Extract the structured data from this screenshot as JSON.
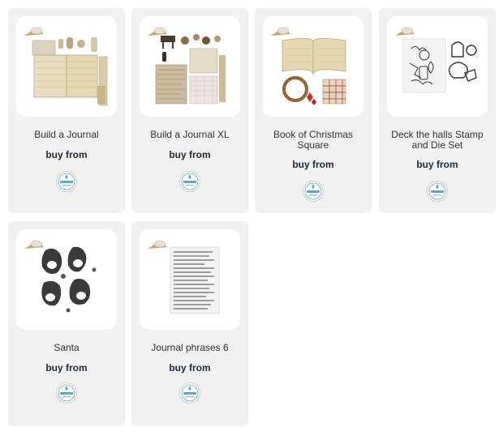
{
  "products": [
    {
      "title": "Build a Journal",
      "buy_label": "buy from",
      "retailer_logo": "elizabeth-craft-designs-logo",
      "image": "journal-papers-and-tags"
    },
    {
      "title": "Build a Journal XL",
      "buy_label": "buy from",
      "retailer_logo": "elizabeth-craft-designs-logo",
      "image": "journal-xl-papers-and-embellishments"
    },
    {
      "title": "Book of Christmas Square",
      "buy_label": "buy from",
      "retailer_logo": "elizabeth-craft-designs-logo",
      "image": "open-book-wreath-and-plaid"
    },
    {
      "title": "Deck the halls Stamp and Die Set",
      "buy_label": "buy from",
      "retailer_logo": "elizabeth-craft-designs-logo",
      "image": "christmas-stamp-set"
    },
    {
      "title": "Santa",
      "buy_label": "buy from",
      "retailer_logo": "elizabeth-craft-designs-logo",
      "image": "santa-stamp-set"
    },
    {
      "title": "Journal phrases 6",
      "buy_label": "buy from",
      "retailer_logo": "elizabeth-craft-designs-logo",
      "image": "journal-phrases-stamp"
    }
  ],
  "colors": {
    "card_bg": "#f1f1f1",
    "logo_teal": "#5aa9c2",
    "text_dark": "#1d2a3a"
  }
}
